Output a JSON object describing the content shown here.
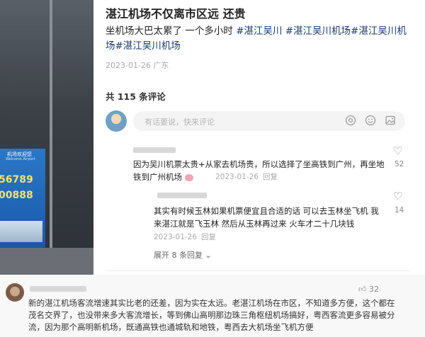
{
  "post": {
    "title": "湛江机场不仅离市区远 还贵",
    "body_text": "坐机场大巴太累了 一个多小时",
    "tags": [
      "#湛江吴川",
      "#湛江吴川机场",
      "#湛江吴川机场",
      "#湛江吴川机场"
    ],
    "meta": "2023-01-26 广东"
  },
  "photo": {
    "bus_sign": "机场欢迎您",
    "bus_sign_sub": "Welcome Airport",
    "phone_1": "56789",
    "phone_2": "00888"
  },
  "comments_header": "共 115 条评论",
  "comment_input": {
    "placeholder": "有话要说，快来评论",
    "icons": [
      "at-icon",
      "emoji-icon",
      "image-icon"
    ]
  },
  "comments": [
    {
      "text": "因为吴川机票太贵+从家去机场贵，所以选择了坐高铁到广州，再坐地铁到广州机场",
      "emoji": "pig-face-emoji",
      "meta": "2023-01-26",
      "reply": "回复",
      "likes": "52"
    },
    {
      "text": "其实有时候玉林如果机票便宜且合适的话 可以去玉林坐飞机 我来湛江就是飞玉林 然后从玉林再过来 火车才二十几块钱",
      "meta": "2023-01-26",
      "reply": "回复",
      "likes": "14"
    }
  ],
  "expand_replies": "展开 8 条回复",
  "bottom_comment": {
    "likes": "32",
    "text": "新的湛江机场客流增速其实比老的还差，因为实在太远。老湛江机场在市区，不知道多方便，这个都在茂名交界了，也没带来多大客流增长，等到佛山高明那边珠三角枢纽机场搞好，粤西客流更多容易被分流，因为那个高明新机场，既通高铁也通城轨和地铁，粤西去大机场坐飞机方便"
  }
}
